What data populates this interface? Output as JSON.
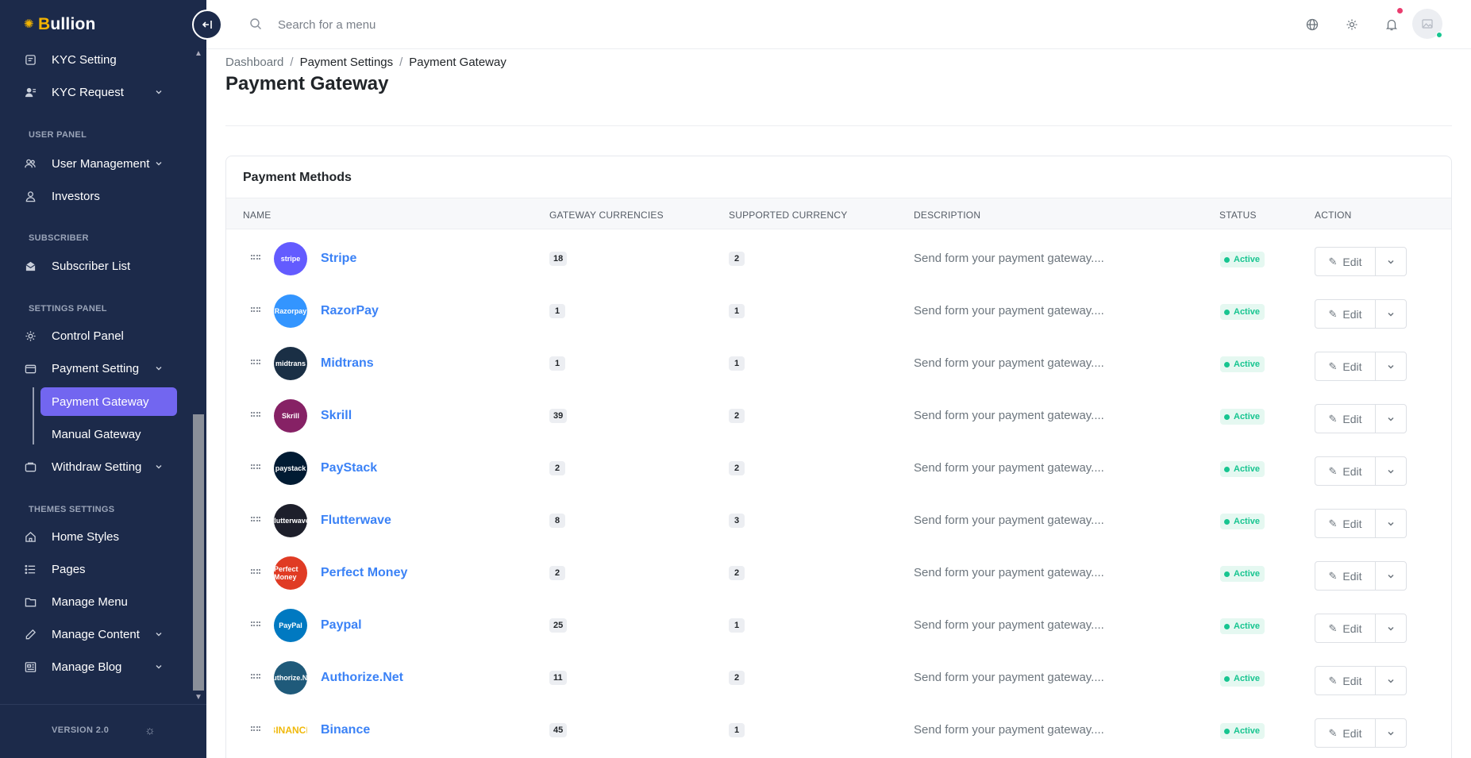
{
  "brand": {
    "name": "Bullion",
    "accent": "#f4b400"
  },
  "sidebar": {
    "items": [
      {
        "label": "KYC Setting",
        "icon": "kyc-setting-icon",
        "chevron": false
      },
      {
        "label": "KYC Request",
        "icon": "kyc-request-icon",
        "chevron": true
      },
      {
        "label": "User Management",
        "icon": "users-icon",
        "chevron": true
      },
      {
        "label": "Investors",
        "icon": "investor-icon",
        "chevron": false
      },
      {
        "label": "Subscriber List",
        "icon": "subscriber-icon",
        "chevron": false
      },
      {
        "label": "Control Panel",
        "icon": "gear-icon",
        "chevron": false
      },
      {
        "label": "Payment Setting",
        "icon": "wallet-icon",
        "chevron": true
      },
      {
        "label": "Withdraw Setting",
        "icon": "withdraw-icon",
        "chevron": true
      },
      {
        "label": "Home Styles",
        "icon": "home-icon",
        "chevron": false
      },
      {
        "label": "Pages",
        "icon": "list-icon",
        "chevron": false
      },
      {
        "label": "Manage Menu",
        "icon": "folder-icon",
        "chevron": false
      },
      {
        "label": "Manage Content",
        "icon": "pen-icon",
        "chevron": true
      },
      {
        "label": "Manage Blog",
        "icon": "blog-icon",
        "chevron": true
      }
    ],
    "sections": [
      "USER PANEL",
      "SUBSCRIBER",
      "SETTINGS PANEL",
      "THEMES SETTINGS"
    ],
    "sub_items": [
      {
        "label": "Payment Gateway",
        "active": true
      },
      {
        "label": "Manual Gateway",
        "active": false
      }
    ],
    "version": "VERSION 2.0",
    "bg_color": "#1c2a4a",
    "active_color": "#7266f0"
  },
  "header": {
    "search_placeholder": "Search for a menu"
  },
  "breadcrumb": [
    "Dashboard",
    "Payment Settings",
    "Payment Gateway"
  ],
  "page_title": "Payment Gateway",
  "card": {
    "title": "Payment Methods",
    "columns": [
      "NAME",
      "GATEWAY CURRENCIES",
      "SUPPORTED CURRENCY",
      "DESCRIPTION",
      "STATUS",
      "ACTION"
    ],
    "rows": [
      {
        "name": "Stripe",
        "gateway_currencies": "18",
        "supported_currency": "2",
        "description": "Send form your payment gateway....",
        "status": "Active",
        "logo_text": "stripe",
        "logo_color": "#635bff"
      },
      {
        "name": "RazorPay",
        "gateway_currencies": "1",
        "supported_currency": "1",
        "description": "Send form your payment gateway....",
        "status": "Active",
        "logo_text": "Razorpay",
        "logo_color": "#3395ff"
      },
      {
        "name": "Midtrans",
        "gateway_currencies": "1",
        "supported_currency": "1",
        "description": "Send form your payment gateway....",
        "status": "Active",
        "logo_text": "midtrans",
        "logo_color": "#1a2f45"
      },
      {
        "name": "Skrill",
        "gateway_currencies": "39",
        "supported_currency": "2",
        "description": "Send form your payment gateway....",
        "status": "Active",
        "logo_text": "Skrill",
        "logo_color": "#862165"
      },
      {
        "name": "PayStack",
        "gateway_currencies": "2",
        "supported_currency": "2",
        "description": "Send form your payment gateway....",
        "status": "Active",
        "logo_text": "paystack",
        "logo_color": "#011b33"
      },
      {
        "name": "Flutterwave",
        "gateway_currencies": "8",
        "supported_currency": "3",
        "description": "Send form your payment gateway....",
        "status": "Active",
        "logo_text": "flutterwave",
        "logo_color": "#1d1f2b"
      },
      {
        "name": "Perfect Money",
        "gateway_currencies": "2",
        "supported_currency": "2",
        "description": "Send form your payment gateway....",
        "status": "Active",
        "logo_text": "Perfect Money",
        "logo_color": "#e03b24"
      },
      {
        "name": "Paypal",
        "gateway_currencies": "25",
        "supported_currency": "1",
        "description": "Send form your payment gateway....",
        "status": "Active",
        "logo_text": "PayPal",
        "logo_color": "#0079c1"
      },
      {
        "name": "Authorize.Net",
        "gateway_currencies": "11",
        "supported_currency": "2",
        "description": "Send form your payment gateway....",
        "status": "Active",
        "logo_text": "Authorize.Net",
        "logo_color": "#1f5a7a"
      },
      {
        "name": "Binance",
        "gateway_currencies": "45",
        "supported_currency": "1",
        "description": "Send form your payment gateway....",
        "status": "Active",
        "logo_text": "BINANCE",
        "logo_color": "#ffffff"
      }
    ],
    "edit_label": "Edit",
    "link_color": "#3b82f6",
    "status_color": "#17c590"
  }
}
